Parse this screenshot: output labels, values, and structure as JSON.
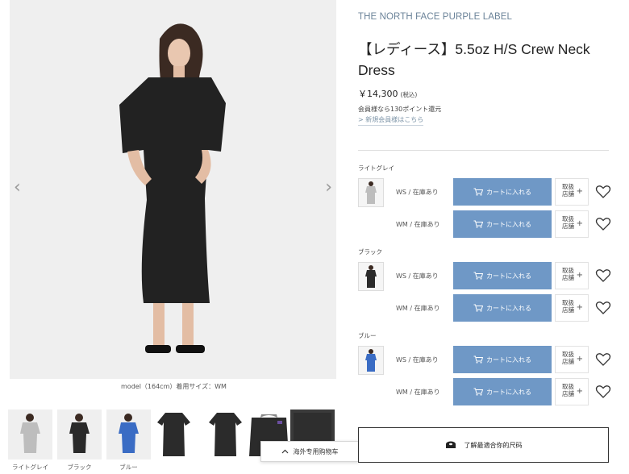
{
  "gallery": {
    "caption": "model（164cm）着用サイズ：WM",
    "prev_icon": "‹",
    "next_icon": "›",
    "thumbnails": [
      {
        "label": "ライトグレイ",
        "color": "#bdbdbd"
      },
      {
        "label": "ブラック",
        "color": "#2a2a2a"
      },
      {
        "label": "ブルー",
        "color": "#3a6cc4"
      },
      {
        "label": "",
        "color": "#2b2b2b"
      },
      {
        "label": "",
        "color": "#2b2b2b"
      },
      {
        "label": "",
        "color": "#2b2b2b"
      },
      {
        "label": "",
        "color": "#2b2b2b"
      }
    ]
  },
  "overseas_cart": {
    "label": "海外专用购物车",
    "icon": "chevron-up-icon"
  },
  "product": {
    "brand": "THE NORTH FACE PURPLE LABEL",
    "title": "【レディース】5.5oz H/S Crew Neck Dress",
    "price": "￥14,300",
    "tax_note": "(税込)",
    "points_note": "会員様なら130ポイント還元",
    "new_member_link": "> 新規会員様はこちら"
  },
  "colors": [
    {
      "name": "ライトグレイ",
      "swatch_color": "#bdbdbd",
      "sizes": [
        {
          "size": "WS / 在庫あり"
        },
        {
          "size": "WM / 在庫あり"
        }
      ]
    },
    {
      "name": "ブラック",
      "swatch_color": "#2a2a2a",
      "sizes": [
        {
          "size": "WS / 在庫あり"
        },
        {
          "size": "WM / 在庫あり"
        }
      ]
    },
    {
      "name": "ブルー",
      "swatch_color": "#3a6cc4",
      "sizes": [
        {
          "size": "WS / 在庫あり"
        },
        {
          "size": "WM / 在庫あり"
        }
      ]
    }
  ],
  "actions": {
    "cart_label": "カートに入れる",
    "store_line1": "取扱",
    "store_line2": "店舗",
    "store_plus": "+"
  },
  "size_guide": {
    "label": "了解最適合你的尺码",
    "icon": "size-guide-icon"
  },
  "theme": {
    "brand_color": "#6b8399",
    "cart_button_color": "#6f98c6"
  }
}
